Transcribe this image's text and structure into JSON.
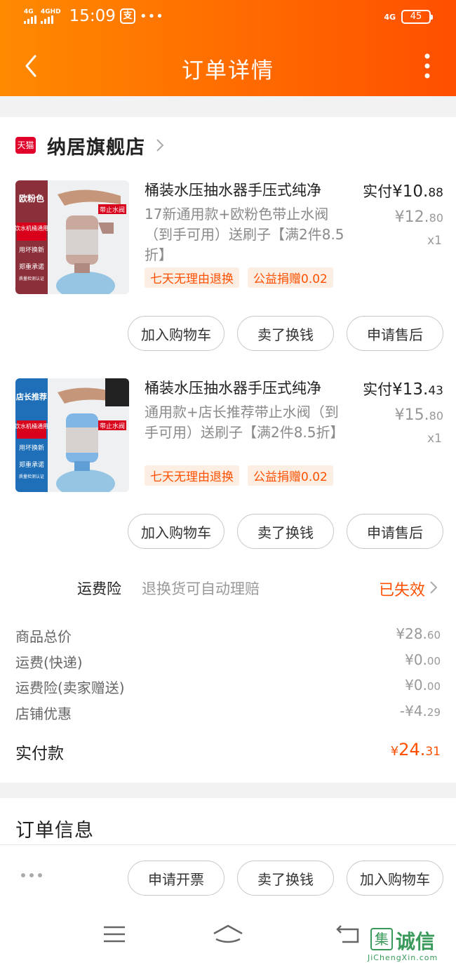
{
  "status_bar": {
    "signal1": "4G",
    "signal2": "4GHD",
    "time": "15:09",
    "app_icon_glyph": "支",
    "dots": "•••",
    "network": "4G",
    "battery": "45"
  },
  "nav": {
    "title": "订单详情"
  },
  "store": {
    "badge": "天猫",
    "name": "纳居旗舰店"
  },
  "items": [
    {
      "title": "桶装水压抽水器手压式纯净",
      "spec": "17新通用款+欧粉色带止水阀（到手可用）送刷子【满2件8.5折】",
      "tags": [
        "七天无理由退换",
        "公益捐赠0.02"
      ],
      "pay_label": "实付",
      "pay_price_int": "¥10.",
      "pay_price_dec": "88",
      "orig_price_int": "¥12.",
      "orig_price_dec": "80",
      "qty": "x1",
      "image_color_label": "欧粉色",
      "image_texts": [
        "饮水机桶通用",
        "用坏换新",
        "郑重承诺",
        "质量检测认证",
        "带止水阀"
      ],
      "actions": [
        "加入购物车",
        "卖了换钱",
        "申请售后"
      ]
    },
    {
      "title": "桶装水压抽水器手压式纯净",
      "spec": "通用款+店长推荐带止水阀（到手可用）送刷子【满2件8.5折】",
      "tags": [
        "七天无理由退换",
        "公益捐赠0.02"
      ],
      "pay_label": "实付",
      "pay_price_int": "¥13.",
      "pay_price_dec": "43",
      "orig_price_int": "¥15.",
      "orig_price_dec": "80",
      "qty": "x1",
      "image_color_label": "店长推荐",
      "image_texts": [
        "饮水机桶通用",
        "用坏换新",
        "郑重承诺",
        "质量检测认证",
        "带止水阀"
      ],
      "actions": [
        "加入购物车",
        "卖了换钱",
        "申请售后"
      ]
    }
  ],
  "insurance": {
    "label": "运费险",
    "desc": "退换货可自动理赔",
    "status": "已失效"
  },
  "summary": [
    {
      "label": "商品总价",
      "int": "¥28.",
      "dec": "60"
    },
    {
      "label": "运费(快递)",
      "int": "¥0.",
      "dec": "00"
    },
    {
      "label": "运费险(卖家赠送)",
      "int": "¥0.",
      "dec": "00"
    },
    {
      "label": "店铺优惠",
      "int": "-¥4.",
      "dec": "29"
    }
  ],
  "total": {
    "label": "实付款",
    "yen": "¥",
    "int": "24.",
    "dec": "31"
  },
  "order_info": {
    "title": "订单信息"
  },
  "bottom_actions": [
    "申请开票",
    "卖了换钱",
    "加入购物车"
  ],
  "watermark": {
    "text": "诚信",
    "glyph": "集",
    "sub": "JiChengXin.com"
  },
  "colors": {
    "accent": "#ff5000",
    "header_start": "#ff8a00",
    "header_end": "#ff4f00",
    "tmall": "#e0002a"
  }
}
